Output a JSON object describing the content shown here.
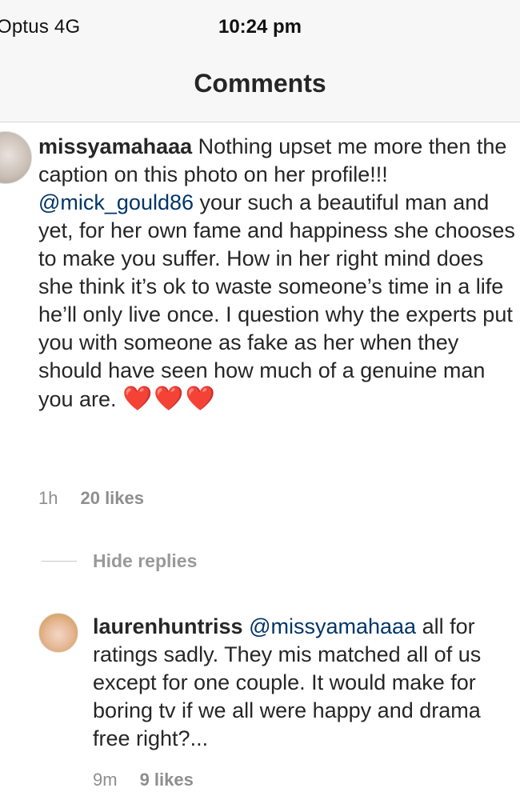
{
  "status_bar": {
    "carrier": "Optus  4G",
    "time": "10:24 pm"
  },
  "nav": {
    "title": "Comments"
  },
  "comments": [
    {
      "username": "missyamahaaa",
      "text_before_mention": " Nothing upset me more then the caption on this photo on her profile!!! ",
      "mention": "@mick_gould86",
      "text_after_mention": "  your such a beautiful man and yet, for her own fame and happiness she chooses to make you suffer. How in her right mind does she think it’s ok to waste someone’s time in a life he’ll only live once. I question why the experts put you with someone as fake as her when they should have seen how much of a genuine man you are. ",
      "emoji": "❤️❤️❤️",
      "time": "1h",
      "likes": "20 likes"
    }
  ],
  "hide_replies_label": "Hide replies",
  "replies": [
    {
      "username": "laurenhuntriss",
      "mention": "@missyamahaaa",
      "text": " all for ratings sadly. They mis matched all of us except for one couple. It would make for boring tv if we all were happy and drama free right?...",
      "time": "9m",
      "likes": "9 likes"
    }
  ],
  "colors": {
    "text": "#262626",
    "meta": "#8e8e8e",
    "heart": "#ed4956",
    "bar_bg": "#f7f7f7"
  }
}
